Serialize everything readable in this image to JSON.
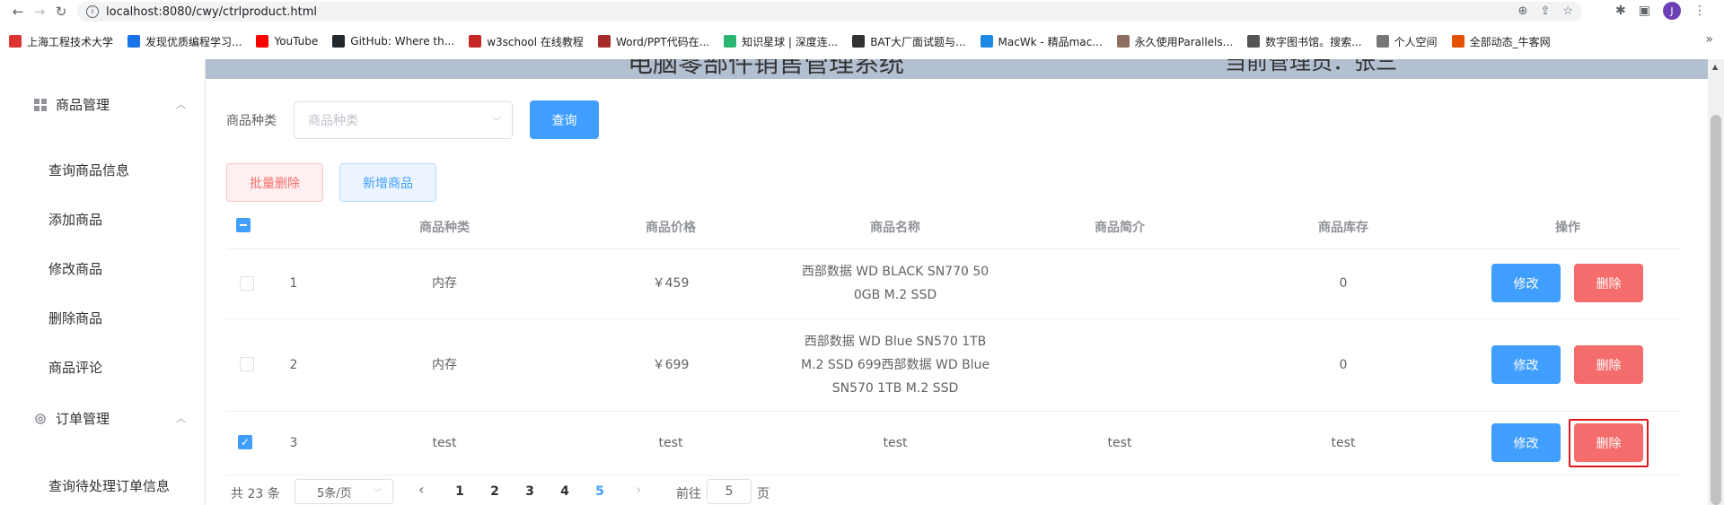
{
  "browser": {
    "url": "localhost:8080/cwy/ctrlproduct.html",
    "avatar_letter": "J",
    "bookmarks": [
      {
        "label": "上海工程技术大学",
        "color": "#d33"
      },
      {
        "label": "发现优质编程学习...",
        "color": "#1a73e8"
      },
      {
        "label": "YouTube",
        "color": "#f00"
      },
      {
        "label": "GitHub: Where th...",
        "color": "#24292e"
      },
      {
        "label": "w3school 在线教程",
        "color": "#c62828"
      },
      {
        "label": "Word/PPT代码在...",
        "color": "#a52a2a"
      },
      {
        "label": "知识星球 | 深度连...",
        "color": "#2bb673"
      },
      {
        "label": "BAT大厂面试题与...",
        "color": "#333"
      },
      {
        "label": "MacWk - 精品mac...",
        "color": "#1e88e5"
      },
      {
        "label": "永久使用Parallels...",
        "color": "#8d6e63"
      },
      {
        "label": "数字图书馆。搜索...",
        "color": "#555"
      },
      {
        "label": "个人空间",
        "color": "#777"
      },
      {
        "label": "全部动态_牛客网",
        "color": "#e65100"
      }
    ]
  },
  "header": {
    "title": "电脑零部件销售管理系统",
    "user": "当前管理员：张三"
  },
  "sidebar": {
    "group1": {
      "label": "商品管理",
      "arrow": "︿"
    },
    "items": [
      "查询商品信息",
      "添加商品",
      "修改商品",
      "删除商品",
      "商品评论"
    ],
    "group2": {
      "label": "订单管理",
      "arrow": "︿"
    },
    "items2": [
      "查询待处理订单信息"
    ]
  },
  "filter": {
    "label": "商品种类",
    "placeholder": "商品种类",
    "query_button": "查询",
    "batch_delete_button": "批量删除",
    "add_button": "新增商品"
  },
  "table": {
    "headers": [
      "商品种类",
      "商品价格",
      "商品名称",
      "商品简介",
      "商品库存",
      "操作"
    ],
    "rows": [
      {
        "id": "1",
        "category": "内存",
        "price": "￥459",
        "name_lines": [
          "西部数据 WD BLACK SN770 50",
          "0GB M.2 SSD"
        ],
        "intro": "",
        "stock": "0",
        "checked": false
      },
      {
        "id": "2",
        "category": "内存",
        "price": "￥699",
        "name_lines": [
          "西部数据 WD Blue SN570 1TB",
          "M.2 SSD 699西部数据 WD Blue",
          "SN570 1TB M.2 SSD"
        ],
        "intro": "",
        "stock": "0",
        "checked": false
      },
      {
        "id": "3",
        "category": "test",
        "price": "test",
        "name_lines": [
          "test"
        ],
        "intro": "test",
        "stock": "test",
        "checked": true
      }
    ],
    "edit_label": "修改",
    "delete_label": "删除"
  },
  "pagination": {
    "total": "共 23 条",
    "page_size": "5条/页",
    "pages": [
      "1",
      "2",
      "3",
      "4",
      "5"
    ],
    "current_page": "5",
    "goto_prefix": "前往",
    "goto_value": "5",
    "goto_suffix": "页",
    "prev": "‹",
    "next": "›"
  }
}
